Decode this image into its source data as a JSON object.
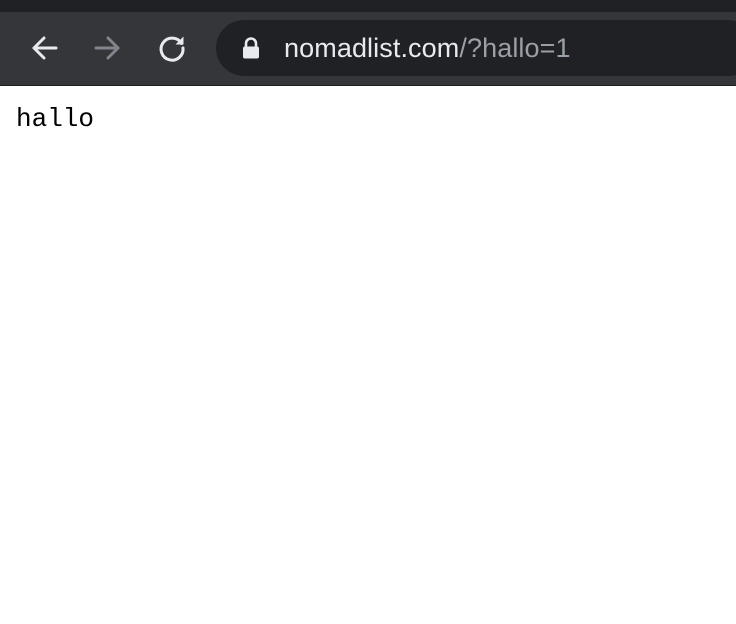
{
  "browser": {
    "toolbar": {
      "back_icon": "arrow-left-icon",
      "forward_icon": "arrow-right-icon",
      "forward_disabled": true,
      "reload_icon": "reload-icon"
    },
    "address_bar": {
      "secure_icon": "lock-icon",
      "host": "nomadlist.com",
      "path": "/?hallo=1"
    },
    "colors": {
      "tabstrip": "#202124",
      "toolbar": "#35363a",
      "omnibox": "#202124",
      "icon_active": "#e8eaed",
      "icon_disabled": "#80868b",
      "url_host": "#e8eaed",
      "url_path": "#9aa0a6"
    }
  },
  "page": {
    "body_text": "hallo"
  }
}
